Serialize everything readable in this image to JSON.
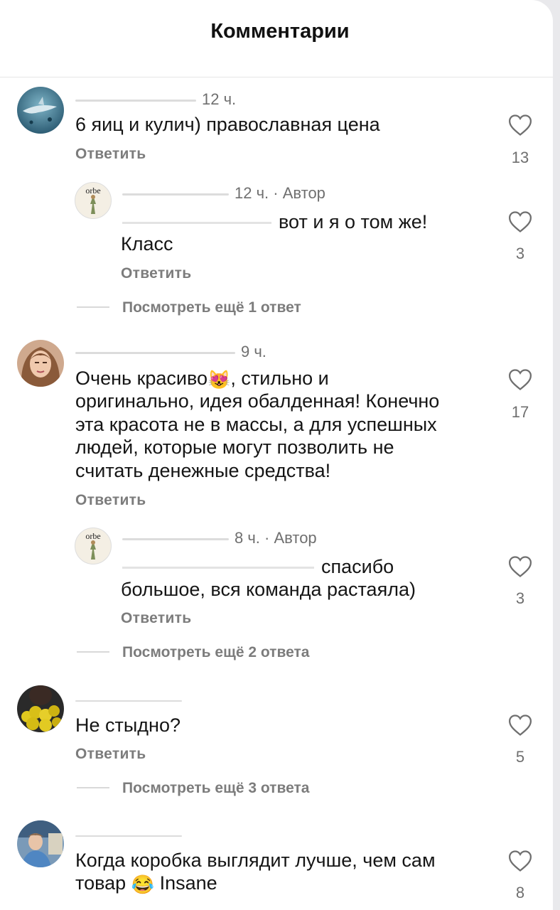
{
  "header": {
    "title": "Комментарии"
  },
  "reply_label": "Ответить",
  "comments": [
    {
      "time": "12 ч.",
      "text": "6 яиц и кулич) православная цена",
      "likes": "13",
      "replies": [
        {
          "time": "12 ч.",
          "author_tag": "Автор",
          "avatar_text": "orbe",
          "text_line1": "вот и я о том же!",
          "text_line2": "Класс",
          "likes": "3"
        }
      ],
      "more": "Посмотреть ещё 1 ответ"
    },
    {
      "time": "9 ч.",
      "text_part1": "Очень красиво",
      "emoji": "😻",
      "text_part2": ", стильно и",
      "lines": [
        "оригинально, идея обалденная! Конечно",
        "эта красота не в массы, а для успешных",
        "людей, которые могут позволить не",
        "считать денежные средства!"
      ],
      "likes": "17",
      "replies": [
        {
          "time": "8 ч.",
          "author_tag": "Автор",
          "avatar_text": "orbe",
          "text_line1": "спасибо",
          "text_line2": "большое, вся команда растаяла)",
          "likes": "3"
        }
      ],
      "more": "Посмотреть ещё 2 ответа"
    },
    {
      "text": "Не стыдно?",
      "likes": "5",
      "more": "Посмотреть ещё 3 ответа"
    },
    {
      "text_line1": "Когда коробка выглядит лучше, чем сам",
      "text_line2_part1": "товар",
      "emoji": "😂",
      "text_line2_part2": "Insane",
      "likes": "8"
    }
  ],
  "colors": {
    "background": "#ffffff",
    "secondary_text": "#7c7c7c",
    "primary_text": "#151515"
  }
}
